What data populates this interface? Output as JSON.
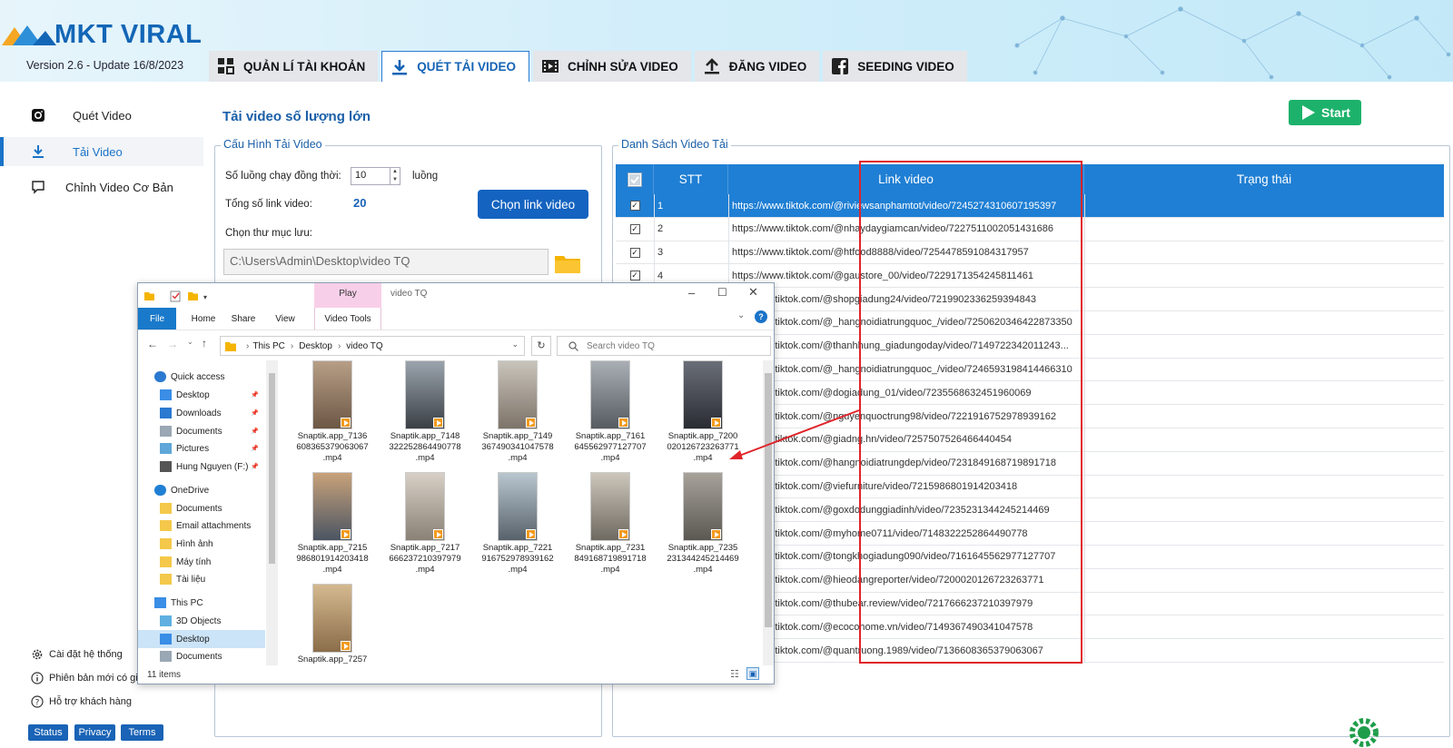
{
  "app": {
    "brand": "MKT VIRAL",
    "version": "Version  2.6 - Update 16/8/2023"
  },
  "tabs": [
    {
      "label": "QUẢN LÍ TÀI KHOẢN",
      "icon": "grid-icon"
    },
    {
      "label": "QUÉT TẢI VIDEO",
      "icon": "download-icon",
      "active": true
    },
    {
      "label": "CHỈNH SỬA VIDEO",
      "icon": "film-icon"
    },
    {
      "label": "ĐĂNG VIDEO",
      "icon": "upload-icon"
    },
    {
      "label": "SEEDING VIDEO",
      "icon": "facebook-icon"
    }
  ],
  "sidebar": {
    "items": [
      {
        "label": "Quét Video",
        "icon": "instagram-icon"
      },
      {
        "label": "Tải Video",
        "icon": "download-icon",
        "active": true
      },
      {
        "label": "Chỉnh Video Cơ Bản",
        "icon": "chat-icon"
      }
    ],
    "bottom": [
      {
        "label": "Cài đặt hệ thống",
        "icon": "gear-icon"
      },
      {
        "label": "Phiên bản mới có gi",
        "icon": "info-icon"
      },
      {
        "label": "Hỗ trợ khách hàng",
        "icon": "help-icon"
      }
    ],
    "pills": [
      "Status",
      "Privacy",
      "Terms"
    ]
  },
  "main": {
    "title": "Tải video số lượng lớn",
    "start_label": "Start",
    "config": {
      "legend": "Cấu Hình Tải Video",
      "threads_label": "Số luồng chạy đồng thời:",
      "threads_value": "10",
      "threads_unit": "luồng",
      "total_label": "Tổng số link video:",
      "total_value": "20",
      "choose_button": "Chọn link video",
      "folder_label": "Chọn thư mục lưu:",
      "folder_path": "C:\\Users\\Admin\\Desktop\\video TQ"
    },
    "list": {
      "legend": "Danh Sách Video Tải",
      "columns": [
        "STT",
        "Link video",
        "Trạng thái"
      ],
      "rows": [
        {
          "stt": "1",
          "link": "https://www.tiktok.com/@riviewsanphamtot/video/7245274310607195397",
          "checked": true,
          "selected": true
        },
        {
          "stt": "2",
          "link": "https://www.tiktok.com/@nhaydaygiamcan/video/7227511002051431686",
          "checked": true
        },
        {
          "stt": "3",
          "link": "https://www.tiktok.com/@htfood8888/video/7254478591084317957",
          "checked": true
        },
        {
          "stt": "4",
          "link": "https://www.tiktok.com/@gaustore_00/video/7229171354245811461",
          "checked": true
        },
        {
          "stt": "",
          "link": "ww.tiktok.com/@shopgiadung24/video/7219902336259394843"
        },
        {
          "stt": "",
          "link": "ww.tiktok.com/@_hangnoidiatrungquoc_/video/7250620346422873350"
        },
        {
          "stt": "",
          "link": "ww.tiktok.com/@thanhhung_giadungoday/video/7149722342011243..."
        },
        {
          "stt": "",
          "link": "ww.tiktok.com/@_hangnoidiatrungquoc_/video/7246593198414466310"
        },
        {
          "stt": "",
          "link": "ww.tiktok.com/@dogiadung_01/video/7235568632451960069"
        },
        {
          "stt": "",
          "link": "ww.tiktok.com/@nguyenquoctrung98/video/7221916752978939162"
        },
        {
          "stt": "",
          "link": "ww.tiktok.com/@giadng.hn/video/7257507526466440454"
        },
        {
          "stt": "",
          "link": "ww.tiktok.com/@hangnoidiatrungdep/video/7231849168719891718"
        },
        {
          "stt": "",
          "link": "ww.tiktok.com/@viefurniture/video/7215986801914203418"
        },
        {
          "stt": "",
          "link": "ww.tiktok.com/@goxdodunggiadinh/video/7235231344245214469"
        },
        {
          "stt": "",
          "link": "ww.tiktok.com/@myhome0711/video/7148322252864490778"
        },
        {
          "stt": "",
          "link": "ww.tiktok.com/@tongkhogiadung090/video/7161645562977127707"
        },
        {
          "stt": "",
          "link": "ww.tiktok.com/@hieodangreporter/video/7200020126723263771"
        },
        {
          "stt": "",
          "link": "ww.tiktok.com/@thubear.review/video/7217666237210397979"
        },
        {
          "stt": "",
          "link": "ww.tiktok.com/@ecocohome.vn/video/7149367490341047578"
        },
        {
          "stt": "",
          "link": "ww.tiktok.com/@quantruong.1989/video/7136608365379063067"
        }
      ]
    }
  },
  "explorer": {
    "title": "video TQ",
    "tools_tab": "Play",
    "ribbon": [
      "File",
      "Home",
      "Share",
      "View",
      "Video Tools"
    ],
    "breadcrumb": [
      "This PC",
      "Desktop",
      "video TQ"
    ],
    "search_placeholder": "Search video TQ",
    "nav": [
      {
        "label": "Quick access",
        "type": "star",
        "level": 0
      },
      {
        "label": "Desktop",
        "type": "desk",
        "level": 1,
        "pin": true
      },
      {
        "label": "Downloads",
        "type": "down",
        "level": 1,
        "pin": true
      },
      {
        "label": "Documents",
        "type": "doc",
        "level": 1,
        "pin": true
      },
      {
        "label": "Pictures",
        "type": "pic",
        "level": 1,
        "pin": true
      },
      {
        "label": "Hung Nguyen (F:)",
        "type": "drive",
        "level": 1,
        "pin": true
      },
      {
        "label": "OneDrive",
        "type": "cloud",
        "level": 0
      },
      {
        "label": "Documents",
        "type": "folder",
        "level": 1
      },
      {
        "label": "Email attachments",
        "type": "folder",
        "level": 1
      },
      {
        "label": "Hình ảnh",
        "type": "folder",
        "level": 1
      },
      {
        "label": "Máy tính",
        "type": "folder",
        "level": 1
      },
      {
        "label": "Tài liệu",
        "type": "folder",
        "level": 1
      },
      {
        "label": "This PC",
        "type": "pc",
        "level": 0
      },
      {
        "label": "3D Objects",
        "type": "obj",
        "level": 1
      },
      {
        "label": "Desktop",
        "type": "desk",
        "level": 1,
        "selected": true
      },
      {
        "label": "Documents",
        "type": "doc",
        "level": 1
      }
    ],
    "files": [
      "Snaptik.app_7136\n608365379063067\n.mp4",
      "Snaptik.app_7148\n322252864490778\n.mp4",
      "Snaptik.app_7149\n367490341047578\n.mp4",
      "Snaptik.app_7161\n645562977127707\n.mp4",
      "Snaptik.app_7200\n020126723263771\n.mp4",
      "Snaptik.app_7215\n986801914203418\n.mp4",
      "Snaptik.app_7217\n666237210397979\n.mp4",
      "Snaptik.app_7221\n916752978939162\n.mp4",
      "Snaptik.app_7231\n849168719891718\n.mp4",
      "Snaptik.app_7235\n231344245214469\n.mp4",
      "Snaptik.app_7257"
    ],
    "status": "11 items"
  },
  "colors": {
    "accent": "#1f7fd4",
    "brand": "#1366b6",
    "start": "#1db26b",
    "highlight": "#e0242a"
  }
}
